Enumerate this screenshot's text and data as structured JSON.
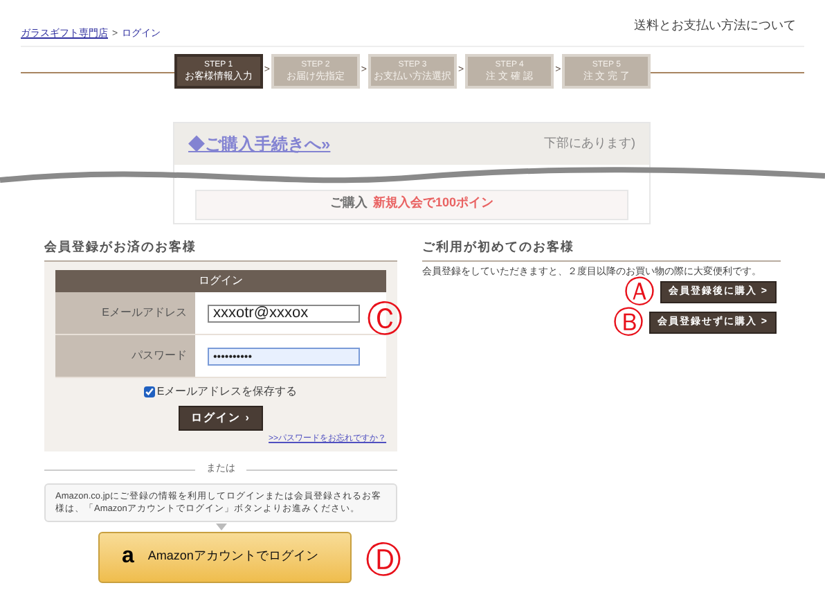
{
  "header": {
    "breadcrumb": [
      {
        "label": "ガラスギフト専門店",
        "link": true
      },
      {
        "label": "ログイン",
        "link": false
      }
    ],
    "breadcrumb_separator": ">",
    "shipping_link": "送料とお支払い方法について"
  },
  "steps": [
    {
      "step": "STEP 1",
      "label": "お客様情報入力",
      "selected": true
    },
    {
      "step": "STEP 2",
      "label": "お届け先指定",
      "selected": false
    },
    {
      "step": "STEP 3",
      "label": "お支払い方法選択",
      "selected": false
    },
    {
      "step": "STEP 4",
      "label": "注 文 確 認",
      "selected": false
    },
    {
      "step": "STEP 5",
      "label": "注 文 完 了",
      "selected": false
    }
  ],
  "step_arrow": ">",
  "faded_excerpt": {
    "link": "◆ご購入手続きへ»",
    "note": "下部にあります)",
    "box_title": "ご購入",
    "promo": "新規入会で100ポイン"
  },
  "member": {
    "heading": "会員登録がお済のお客様",
    "panel_title": "ログイン",
    "fields": [
      {
        "label": "Eメールアドレス",
        "value": "xxxotr@xxxox",
        "focused": false
      },
      {
        "label": "パスワード",
        "value": "••••••••••",
        "focused": true
      }
    ],
    "remember": {
      "label": "Eメールアドレスを保存する",
      "checked": true
    },
    "login_button": "ログイン",
    "login_arrow": "›",
    "forgot_link": ">>パスワードをお忘れですか？",
    "marker": "Ⓒ"
  },
  "or_label": "または",
  "amazon": {
    "note": "Amazon.co.jpにご登録の情報を利用してログインまたは会員登録されるお客様は、「Amazonアカウントでログイン」ボタンよりお進みください。",
    "logo": "a",
    "button": "Amazonアカウントでログイン",
    "marker": "Ⓓ"
  },
  "new_customer": {
    "heading": "ご利用が初めてのお客様",
    "description": "会員登録をしていただきますと、２度目以降のお買い物の際に大変便利です。",
    "buttons": [
      {
        "label": "会員登録後に購入",
        "marker": "Ⓐ"
      },
      {
        "label": "会員登録せずに購入",
        "marker": "Ⓑ"
      }
    ],
    "button_arrow": ">"
  }
}
